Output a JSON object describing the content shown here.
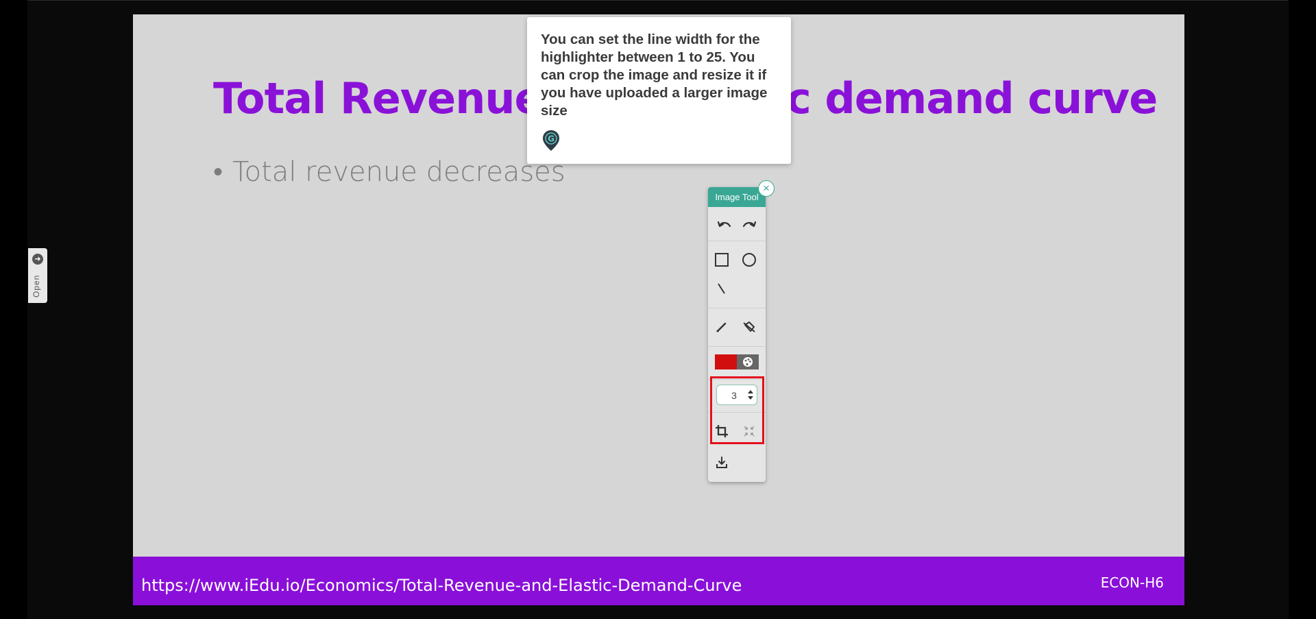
{
  "slide": {
    "title": "Total Revenue and elastic demand curve",
    "bullet": "Total revenue decreases",
    "footer_url": "https://www.iEdu.io/Economics/Total-Revenue-and-Elastic-Demand-Curve",
    "footer_code": "ECON-H6"
  },
  "side_tab": {
    "label": "Open",
    "icon": "arrow-right-icon"
  },
  "tooltip": {
    "text": "You can set the line width for the highlighter between 1 to 25. You can crop the image and resize it if you have uploaded a larger image size",
    "icon": "location-pin-icon"
  },
  "image_tool": {
    "title": "Image Tool",
    "close": "×",
    "line_width_value": "3",
    "colors": {
      "selected": "#d20f0f",
      "header": "#3aa795",
      "highlight": "#e3101b"
    },
    "tools": [
      "undo-icon",
      "redo-icon",
      "rectangle-icon",
      "circle-icon",
      "line-icon",
      "pen-icon",
      "eraser-icon",
      "color-swatch",
      "palette-icon",
      "crop-icon",
      "resize-icon",
      "download-icon"
    ]
  }
}
